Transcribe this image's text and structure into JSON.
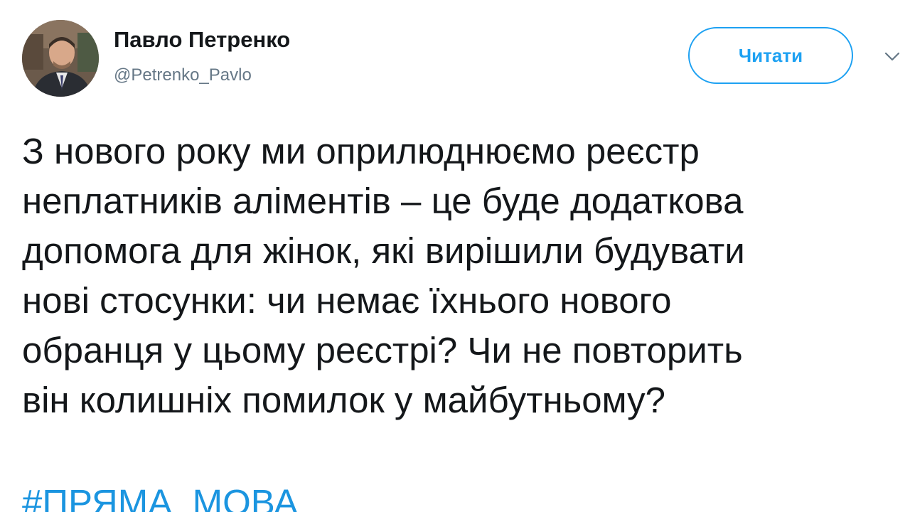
{
  "author": {
    "name": "Павло Петренко",
    "handle": "@Petrenko_Pavlo"
  },
  "actions": {
    "follow_label": "Читати",
    "more_icon": "chevron-down-icon"
  },
  "tweet": {
    "lines": [
      "З нового року ми оприлюднюємо реєстр",
      "неплатників аліментів – це буде додаткова",
      "допомога для жінок, які вирішили будувати",
      "нові стосунки: чи немає їхнього нового",
      "обранця у цьому реєстрі? Чи не повторить",
      "він колишніх помилок у майбутньому?"
    ],
    "hashtag": "#ПРЯМА_МОВА"
  },
  "colors": {
    "accent": "#1da1f2",
    "hashtag": "#1b95e0",
    "text": "#14171a",
    "secondary": "#657786"
  }
}
